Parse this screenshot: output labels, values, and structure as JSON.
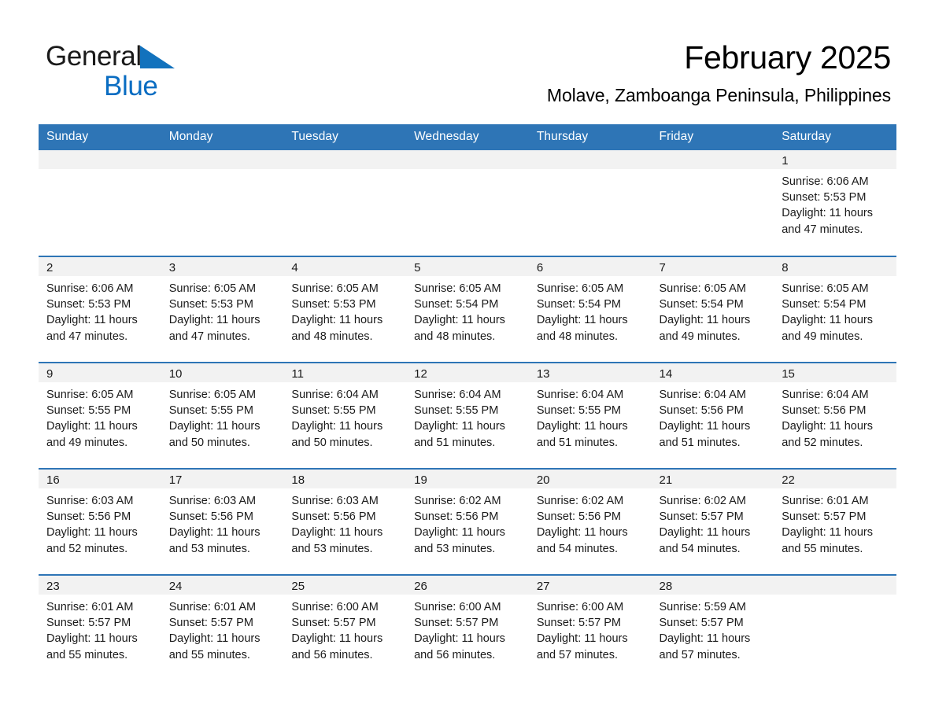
{
  "brand": {
    "word1": "General",
    "word2": "Blue",
    "triangle_icon": "triangle-logo-icon",
    "blue": "#0a6dc2"
  },
  "header": {
    "month_title": "February 2025",
    "location": "Molave, Zamboanga Peninsula, Philippines"
  },
  "theme": {
    "header_bg": "#2e75b6",
    "daynum_bg": "#f2f2f2",
    "row_rule": "#2e75b6",
    "text": "#1a1a1a"
  },
  "calendar": {
    "weekday_headers": [
      "Sunday",
      "Monday",
      "Tuesday",
      "Wednesday",
      "Thursday",
      "Friday",
      "Saturday"
    ],
    "weeks": [
      [
        {
          "blank": true
        },
        {
          "blank": true
        },
        {
          "blank": true
        },
        {
          "blank": true
        },
        {
          "blank": true
        },
        {
          "blank": true
        },
        {
          "day": "1",
          "sunrise": "Sunrise: 6:06 AM",
          "sunset": "Sunset: 5:53 PM",
          "daylight_l1": "Daylight: 11 hours",
          "daylight_l2": "and 47 minutes."
        }
      ],
      [
        {
          "day": "2",
          "sunrise": "Sunrise: 6:06 AM",
          "sunset": "Sunset: 5:53 PM",
          "daylight_l1": "Daylight: 11 hours",
          "daylight_l2": "and 47 minutes."
        },
        {
          "day": "3",
          "sunrise": "Sunrise: 6:05 AM",
          "sunset": "Sunset: 5:53 PM",
          "daylight_l1": "Daylight: 11 hours",
          "daylight_l2": "and 47 minutes."
        },
        {
          "day": "4",
          "sunrise": "Sunrise: 6:05 AM",
          "sunset": "Sunset: 5:53 PM",
          "daylight_l1": "Daylight: 11 hours",
          "daylight_l2": "and 48 minutes."
        },
        {
          "day": "5",
          "sunrise": "Sunrise: 6:05 AM",
          "sunset": "Sunset: 5:54 PM",
          "daylight_l1": "Daylight: 11 hours",
          "daylight_l2": "and 48 minutes."
        },
        {
          "day": "6",
          "sunrise": "Sunrise: 6:05 AM",
          "sunset": "Sunset: 5:54 PM",
          "daylight_l1": "Daylight: 11 hours",
          "daylight_l2": "and 48 minutes."
        },
        {
          "day": "7",
          "sunrise": "Sunrise: 6:05 AM",
          "sunset": "Sunset: 5:54 PM",
          "daylight_l1": "Daylight: 11 hours",
          "daylight_l2": "and 49 minutes."
        },
        {
          "day": "8",
          "sunrise": "Sunrise: 6:05 AM",
          "sunset": "Sunset: 5:54 PM",
          "daylight_l1": "Daylight: 11 hours",
          "daylight_l2": "and 49 minutes."
        }
      ],
      [
        {
          "day": "9",
          "sunrise": "Sunrise: 6:05 AM",
          "sunset": "Sunset: 5:55 PM",
          "daylight_l1": "Daylight: 11 hours",
          "daylight_l2": "and 49 minutes."
        },
        {
          "day": "10",
          "sunrise": "Sunrise: 6:05 AM",
          "sunset": "Sunset: 5:55 PM",
          "daylight_l1": "Daylight: 11 hours",
          "daylight_l2": "and 50 minutes."
        },
        {
          "day": "11",
          "sunrise": "Sunrise: 6:04 AM",
          "sunset": "Sunset: 5:55 PM",
          "daylight_l1": "Daylight: 11 hours",
          "daylight_l2": "and 50 minutes."
        },
        {
          "day": "12",
          "sunrise": "Sunrise: 6:04 AM",
          "sunset": "Sunset: 5:55 PM",
          "daylight_l1": "Daylight: 11 hours",
          "daylight_l2": "and 51 minutes."
        },
        {
          "day": "13",
          "sunrise": "Sunrise: 6:04 AM",
          "sunset": "Sunset: 5:55 PM",
          "daylight_l1": "Daylight: 11 hours",
          "daylight_l2": "and 51 minutes."
        },
        {
          "day": "14",
          "sunrise": "Sunrise: 6:04 AM",
          "sunset": "Sunset: 5:56 PM",
          "daylight_l1": "Daylight: 11 hours",
          "daylight_l2": "and 51 minutes."
        },
        {
          "day": "15",
          "sunrise": "Sunrise: 6:04 AM",
          "sunset": "Sunset: 5:56 PM",
          "daylight_l1": "Daylight: 11 hours",
          "daylight_l2": "and 52 minutes."
        }
      ],
      [
        {
          "day": "16",
          "sunrise": "Sunrise: 6:03 AM",
          "sunset": "Sunset: 5:56 PM",
          "daylight_l1": "Daylight: 11 hours",
          "daylight_l2": "and 52 minutes."
        },
        {
          "day": "17",
          "sunrise": "Sunrise: 6:03 AM",
          "sunset": "Sunset: 5:56 PM",
          "daylight_l1": "Daylight: 11 hours",
          "daylight_l2": "and 53 minutes."
        },
        {
          "day": "18",
          "sunrise": "Sunrise: 6:03 AM",
          "sunset": "Sunset: 5:56 PM",
          "daylight_l1": "Daylight: 11 hours",
          "daylight_l2": "and 53 minutes."
        },
        {
          "day": "19",
          "sunrise": "Sunrise: 6:02 AM",
          "sunset": "Sunset: 5:56 PM",
          "daylight_l1": "Daylight: 11 hours",
          "daylight_l2": "and 53 minutes."
        },
        {
          "day": "20",
          "sunrise": "Sunrise: 6:02 AM",
          "sunset": "Sunset: 5:56 PM",
          "daylight_l1": "Daylight: 11 hours",
          "daylight_l2": "and 54 minutes."
        },
        {
          "day": "21",
          "sunrise": "Sunrise: 6:02 AM",
          "sunset": "Sunset: 5:57 PM",
          "daylight_l1": "Daylight: 11 hours",
          "daylight_l2": "and 54 minutes."
        },
        {
          "day": "22",
          "sunrise": "Sunrise: 6:01 AM",
          "sunset": "Sunset: 5:57 PM",
          "daylight_l1": "Daylight: 11 hours",
          "daylight_l2": "and 55 minutes."
        }
      ],
      [
        {
          "day": "23",
          "sunrise": "Sunrise: 6:01 AM",
          "sunset": "Sunset: 5:57 PM",
          "daylight_l1": "Daylight: 11 hours",
          "daylight_l2": "and 55 minutes."
        },
        {
          "day": "24",
          "sunrise": "Sunrise: 6:01 AM",
          "sunset": "Sunset: 5:57 PM",
          "daylight_l1": "Daylight: 11 hours",
          "daylight_l2": "and 55 minutes."
        },
        {
          "day": "25",
          "sunrise": "Sunrise: 6:00 AM",
          "sunset": "Sunset: 5:57 PM",
          "daylight_l1": "Daylight: 11 hours",
          "daylight_l2": "and 56 minutes."
        },
        {
          "day": "26",
          "sunrise": "Sunrise: 6:00 AM",
          "sunset": "Sunset: 5:57 PM",
          "daylight_l1": "Daylight: 11 hours",
          "daylight_l2": "and 56 minutes."
        },
        {
          "day": "27",
          "sunrise": "Sunrise: 6:00 AM",
          "sunset": "Sunset: 5:57 PM",
          "daylight_l1": "Daylight: 11 hours",
          "daylight_l2": "and 57 minutes."
        },
        {
          "day": "28",
          "sunrise": "Sunrise: 5:59 AM",
          "sunset": "Sunset: 5:57 PM",
          "daylight_l1": "Daylight: 11 hours",
          "daylight_l2": "and 57 minutes."
        },
        {
          "blank": true
        }
      ]
    ]
  }
}
